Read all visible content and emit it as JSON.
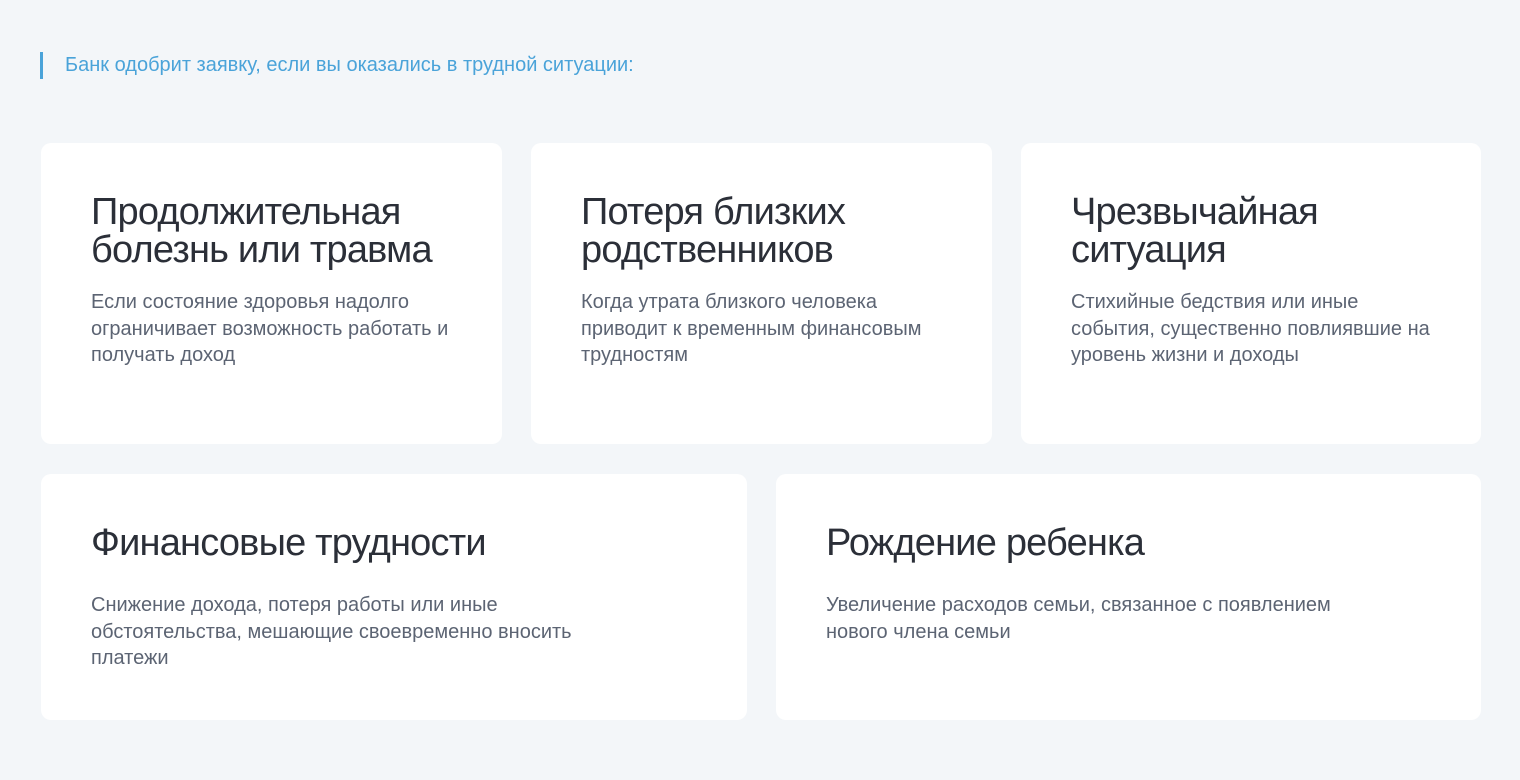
{
  "intro": {
    "text": "Банк одобрит заявку, если вы оказались в трудной ситуации:"
  },
  "colors": {
    "accent": "#4aa3d9",
    "background": "#f3f6f9",
    "card": "#ffffff",
    "title": "#2b2f38",
    "text": "#5c6473"
  },
  "cards": [
    {
      "title": "Продолжительная болезнь или травма",
      "text": "Если состояние здоровья надолго ограничивает возможность работать и получать доход"
    },
    {
      "title": "Потеря близких родственников",
      "text": "Когда утрата близкого человека приводит к временным финансовым трудностям"
    },
    {
      "title": "Чрезвычайная ситуация",
      "text": "Стихийные бедствия или иные события, существенно повлиявшие на уровень жизни и доходы"
    },
    {
      "title": "Финансовые трудности",
      "text": "Снижение дохода, потеря работы или иные обстоятельства, мешающие своевременно вносить платежи"
    },
    {
      "title": "Рождение ребенка",
      "text": "Увеличение расходов семьи, связанное с появлением нового члена семьи"
    }
  ]
}
